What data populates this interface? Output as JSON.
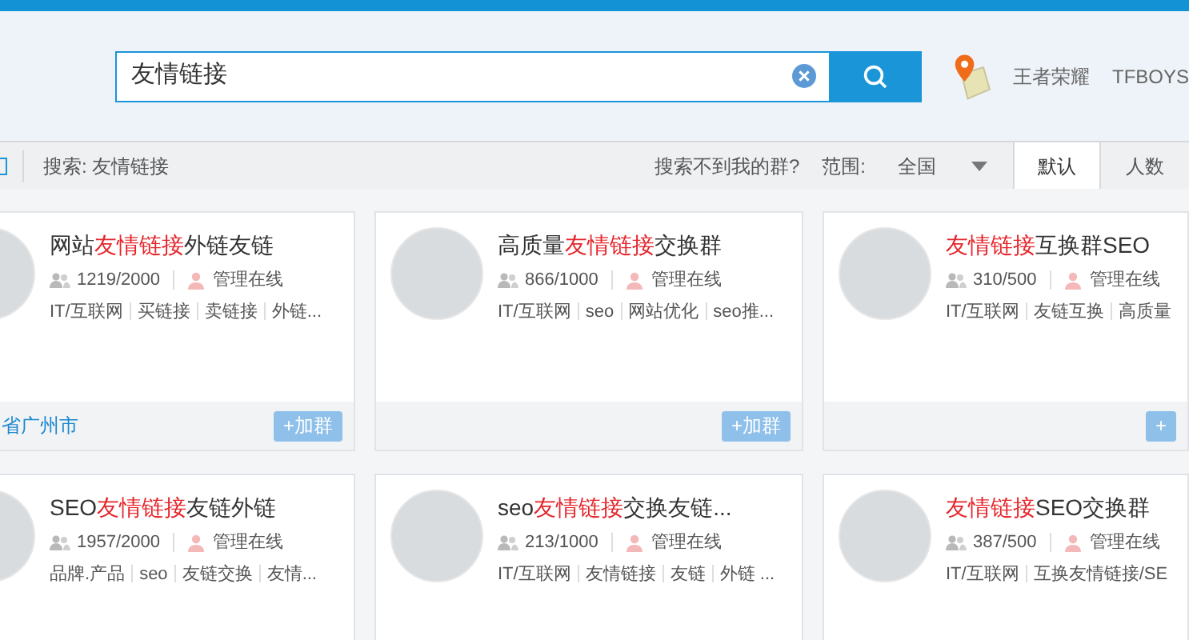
{
  "header": {
    "search": {
      "value": "友情链接"
    },
    "user_links": [
      "王者荣耀",
      "TFBOYS"
    ]
  },
  "filter_bar": {
    "query_label": "搜索: 友情链接",
    "help_link": "搜索不到我的群?",
    "scope_label": "范围:",
    "scope_value": "全国",
    "sort_tabs": [
      {
        "label": "默认",
        "selected": true
      },
      {
        "label": "人数",
        "selected": false
      }
    ]
  },
  "groups": [
    {
      "title": [
        {
          "text": "网站"
        },
        {
          "text": "友情链接",
          "highlight": true
        },
        {
          "text": "外链友链"
        }
      ],
      "members": "1219/2000",
      "admin": "管理在线",
      "tags": [
        "IT/互联网",
        "买链接",
        "卖链接",
        "外链..."
      ],
      "location": "省广州市",
      "join": "+加群"
    },
    {
      "title": [
        {
          "text": "高质量"
        },
        {
          "text": "友情链接",
          "highlight": true
        },
        {
          "text": "交换群"
        }
      ],
      "members": "866/1000",
      "admin": "管理在线",
      "tags": [
        "IT/互联网",
        "seo",
        "网站优化",
        "seo推..."
      ],
      "join": "+加群"
    },
    {
      "title": [
        {
          "text": "友情链接",
          "highlight": true
        },
        {
          "text": "互换群SEO"
        }
      ],
      "members": "310/500",
      "admin": "管理在线",
      "tags": [
        "IT/互联网",
        "友链互换",
        "高质量"
      ],
      "join": "+"
    },
    {
      "title": [
        {
          "text": "SEO"
        },
        {
          "text": "友情链接",
          "highlight": true
        },
        {
          "text": "友链外链"
        }
      ],
      "members": "1957/2000",
      "admin": "管理在线",
      "tags": [
        "品牌.产品",
        "seo",
        "友链交换",
        "友情..."
      ]
    },
    {
      "title": [
        {
          "text": "seo"
        },
        {
          "text": "友情链接",
          "highlight": true
        },
        {
          "text": "交换友链..."
        }
      ],
      "members": "213/1000",
      "admin": "管理在线",
      "tags": [
        "IT/互联网",
        "友情链接",
        "友链",
        "外链 ..."
      ]
    },
    {
      "title": [
        {
          "text": "友情链接",
          "highlight": true
        },
        {
          "text": "SEO交换群"
        }
      ],
      "members": "387/500",
      "admin": "管理在线",
      "tags": [
        "IT/互联网",
        "互换友情链接/SE"
      ]
    }
  ]
}
